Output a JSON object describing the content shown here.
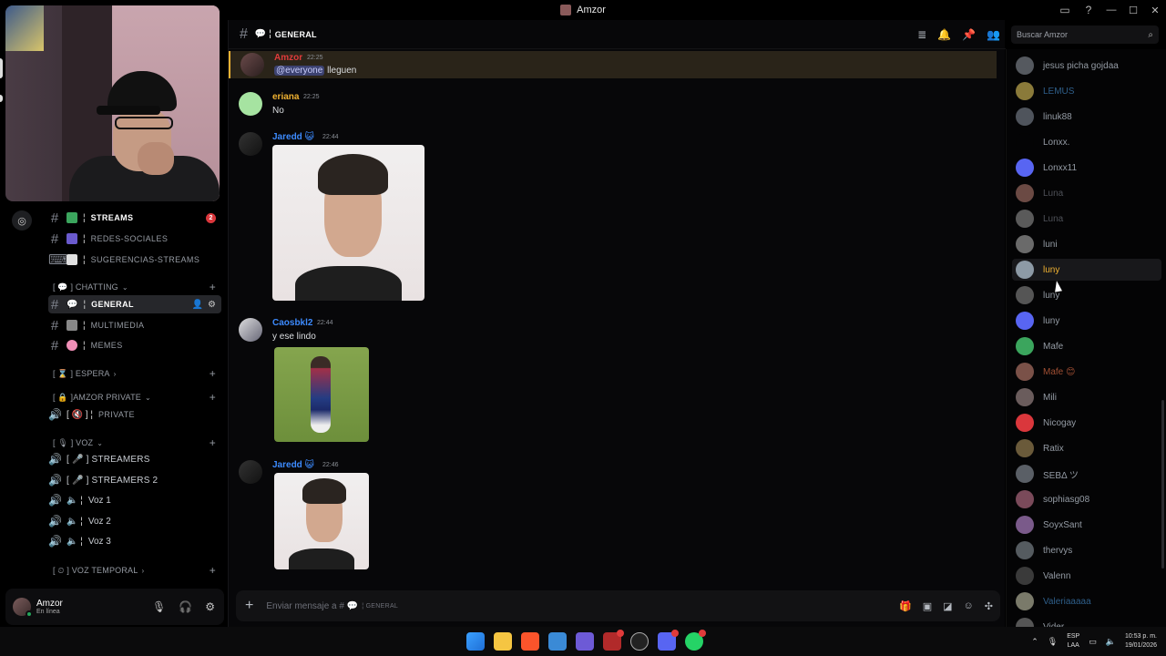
{
  "window": {
    "title": "Amzor"
  },
  "channel_list": {
    "channels_top": [
      {
        "name": "STREAMS",
        "emoji_color": "#3ba55d",
        "badge": "2",
        "bold": true
      },
      {
        "name": "REDES-SOCIALES",
        "emoji_color": "#6a5acd"
      },
      {
        "name": "SUGERENCIAS-STREAMS",
        "emoji_color": "#e0e0e0"
      }
    ],
    "cat_chatting": "[ 💬 ] CHATTING",
    "channels_chat": [
      {
        "name": "GENERAL",
        "active": true
      },
      {
        "name": "MULTIMEDIA"
      },
      {
        "name": "MEMES"
      }
    ],
    "cat_espera": "[ ⌛ ] ESPERA",
    "cat_private": "[ 🔒 ]AMZOR PRIVATE",
    "private_channel": "PRIVATE",
    "cat_voz": "[ 🎙 ] VOZ",
    "voice_channels": [
      {
        "name": "[ 🎤 ] STREAMERS"
      },
      {
        "name": "[ 🎤 ] STREAMERS 2"
      },
      {
        "name": "Voz 1"
      },
      {
        "name": "Voz 2"
      },
      {
        "name": "Voz 3"
      }
    ],
    "cat_voz_temporal": "[ ⏲ ] VOZ TEMPORAL"
  },
  "user_panel": {
    "name": "Amzor",
    "status": "En línea"
  },
  "chat": {
    "channel_name": "GENERAL",
    "messages": [
      {
        "author": "Amzor",
        "author_color": "#e03b3b",
        "time": "22:25",
        "mention": "@everyone",
        "text": "lleguen"
      },
      {
        "author": "eriana",
        "author_color": "#f0b232",
        "time": "22:25",
        "text": "No"
      },
      {
        "author": "Jaredd",
        "author_color": "#3d8bff",
        "badge": "😺",
        "time": "22:44"
      },
      {
        "author": "Caosbkl2",
        "author_color": "#3d8bff",
        "time": "22:44",
        "text": "y ese lindo"
      },
      {
        "author": "Jaredd",
        "author_color": "#3d8bff",
        "badge": "😺",
        "time": "22:46"
      }
    ],
    "composer_placeholder": "Enviar mensaje a # 💬",
    "composer_channel": "GENERAL"
  },
  "search": {
    "placeholder": "Buscar Amzor"
  },
  "members": [
    {
      "name": "jesus picha gojdaa",
      "color": "#949ba4",
      "avatar": "#55595f"
    },
    {
      "name": "LEMUS",
      "color": "#2f5f8a",
      "avatar": "#8a7a3a"
    },
    {
      "name": "linuk88",
      "color": "#949ba4",
      "avatar": "#4f545c"
    },
    {
      "name": "Lonxx.",
      "color": "#949ba4",
      "avatar": "#040405"
    },
    {
      "name": "Lonxx11",
      "color": "#949ba4",
      "avatar": "#5865f2"
    },
    {
      "name": "Luna",
      "color": "#4e5158",
      "avatar": "#6b4a44"
    },
    {
      "name": "Luna",
      "color": "#4e5158",
      "avatar": "#5a5a5a"
    },
    {
      "name": "luni",
      "color": "#949ba4",
      "avatar": "#6a6a6a"
    },
    {
      "name": "luny",
      "color": "#f0b232",
      "avatar": "#8d9aa6"
    },
    {
      "name": "luny",
      "color": "#949ba4",
      "avatar": "#555555"
    },
    {
      "name": "luny",
      "color": "#949ba4",
      "avatar": "#5865f2"
    },
    {
      "name": "Mafe",
      "color": "#949ba4",
      "avatar": "#3ba55d"
    },
    {
      "name": "Mafe 😊",
      "color": "#a14f33",
      "avatar": "#7a5148"
    },
    {
      "name": "Mili",
      "color": "#949ba4",
      "avatar": "#6a5c5c"
    },
    {
      "name": "Nicogay",
      "color": "#949ba4",
      "avatar": "#da373c"
    },
    {
      "name": "Ratix",
      "color": "#949ba4",
      "avatar": "#6a5a3a"
    },
    {
      "name": "SEBΔ ツ",
      "color": "#949ba4",
      "avatar": "#5a5f66"
    },
    {
      "name": "sophiasg08",
      "color": "#949ba4",
      "avatar": "#7a4a5a"
    },
    {
      "name": "SoyxSant",
      "color": "#949ba4",
      "avatar": "#7a5a8a"
    },
    {
      "name": "thervys",
      "color": "#949ba4",
      "avatar": "#555b60"
    },
    {
      "name": "Valenn",
      "color": "#949ba4",
      "avatar": "#3a3a3a"
    },
    {
      "name": "Valeriaaaaa",
      "color": "#2f5f8a",
      "avatar": "#7a7a6a"
    },
    {
      "name": "Vider",
      "color": "#949ba4",
      "avatar": "#555555"
    }
  ],
  "taskbar": {
    "lang_top": "ESP",
    "lang_bottom": "LAA",
    "time": "10:53 p. m.",
    "date": "19/01/2026"
  }
}
